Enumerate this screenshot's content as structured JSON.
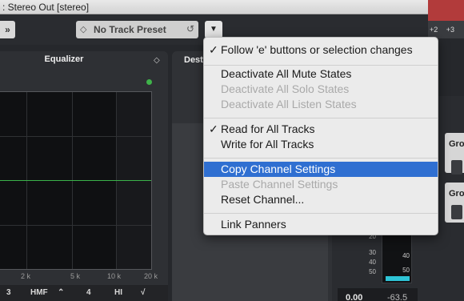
{
  "window": {
    "title": ": Stereo Out [stereo]"
  },
  "right_strip": {
    "ticks": [
      "+2",
      "+3"
    ]
  },
  "toolbar": {
    "nav_glyph": "»",
    "preset_label": "No Track Preset",
    "preset_reset_glyph": "↺",
    "dropdown_glyph": "▼"
  },
  "equalizer": {
    "title": "Equalizer",
    "settings_glyph": "◇",
    "freq_labels": [
      "2 k",
      "5 k",
      "10 k",
      "20 k"
    ],
    "bands": [
      "3",
      "HMF",
      "4",
      "HI"
    ]
  },
  "dest": {
    "title": "Dest"
  },
  "groups": {
    "label1": "Gro",
    "label2": "Gro"
  },
  "meter": {
    "scale_labels": [
      "20",
      "30",
      "40",
      "50"
    ],
    "tick_labels": [
      "40",
      "50"
    ],
    "readout1": "0.00",
    "readout2": "-63.5"
  },
  "menu": {
    "items": [
      {
        "label": "Follow 'e' buttons or selection changes",
        "check": "✓",
        "state": "normal"
      },
      {
        "label": "Deactivate All Mute States",
        "check": "",
        "state": "normal"
      },
      {
        "label": "Deactivate All Solo States",
        "check": "",
        "state": "disabled"
      },
      {
        "label": "Deactivate All Listen States",
        "check": "",
        "state": "disabled"
      },
      {
        "label": "Read for All Tracks",
        "check": "✓",
        "state": "normal"
      },
      {
        "label": "Write for All Tracks",
        "check": "",
        "state": "normal"
      },
      {
        "label": "Copy Channel Settings",
        "check": "",
        "state": "selected"
      },
      {
        "label": "Paste Channel Settings",
        "check": "",
        "state": "disabled"
      },
      {
        "label": "Reset Channel...",
        "check": "",
        "state": "normal"
      },
      {
        "label": "Link Panners",
        "check": "",
        "state": "normal"
      }
    ]
  }
}
